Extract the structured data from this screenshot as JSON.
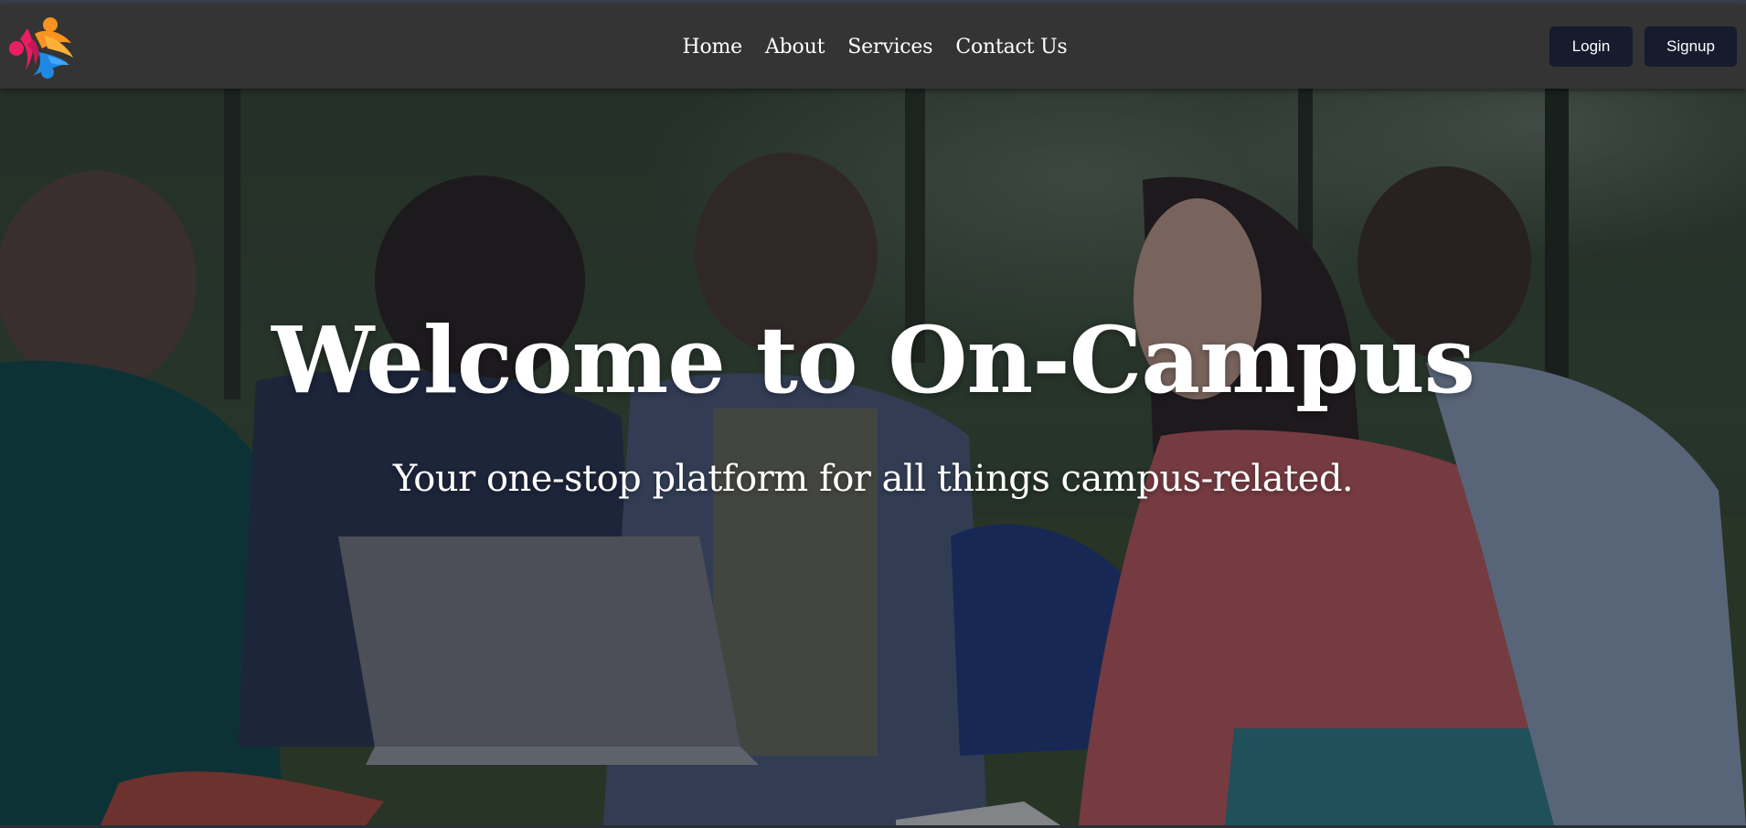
{
  "nav": {
    "links": [
      {
        "label": "Home"
      },
      {
        "label": "About"
      },
      {
        "label": "Services"
      },
      {
        "label": "Contact Us"
      }
    ],
    "login_label": "Login",
    "signup_label": "Signup"
  },
  "hero": {
    "title": "Welcome to On-Campus",
    "subtitle": "Your one-stop platform for all things campus-related."
  },
  "colors": {
    "navbar_bg": "#343434",
    "button_bg": "#161b2e",
    "logo_orange": "#f7931e",
    "logo_pink": "#e91e63",
    "logo_blue": "#1e88e5"
  },
  "icons": {
    "logo": "on-campus-logo-icon"
  }
}
